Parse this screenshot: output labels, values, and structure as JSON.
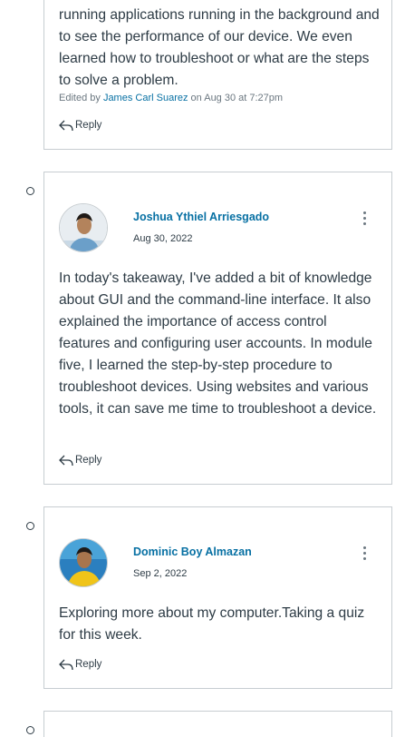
{
  "posts": [
    {
      "body": "running applications running in the background and to see the performance of our device. We even learned how to troubleshoot or what are the steps to solve a problem.",
      "edited_prefix": "Edited by",
      "edited_by": "James Carl Suarez",
      "edited_suffix": "on Aug 30 at 7:27pm",
      "reply_label": "Reply"
    },
    {
      "author": "Joshua Ythiel Arriesgado",
      "date": "Aug 30, 2022",
      "body": "In today's takeaway, I've added a bit of knowledge about GUI and the command-line interface. It also explained the importance of access control features and configuring user accounts. In module five, I learned the step-by-step procedure to troubleshoot devices. Using websites and various tools, it can save me time to troubleshoot a device.",
      "reply_label": "Reply"
    },
    {
      "author": "Dominic Boy Almazan",
      "date": "Sep 2, 2022",
      "body": "Exploring more about my computer.Taking a quiz for this week.",
      "reply_label": "Reply"
    }
  ]
}
